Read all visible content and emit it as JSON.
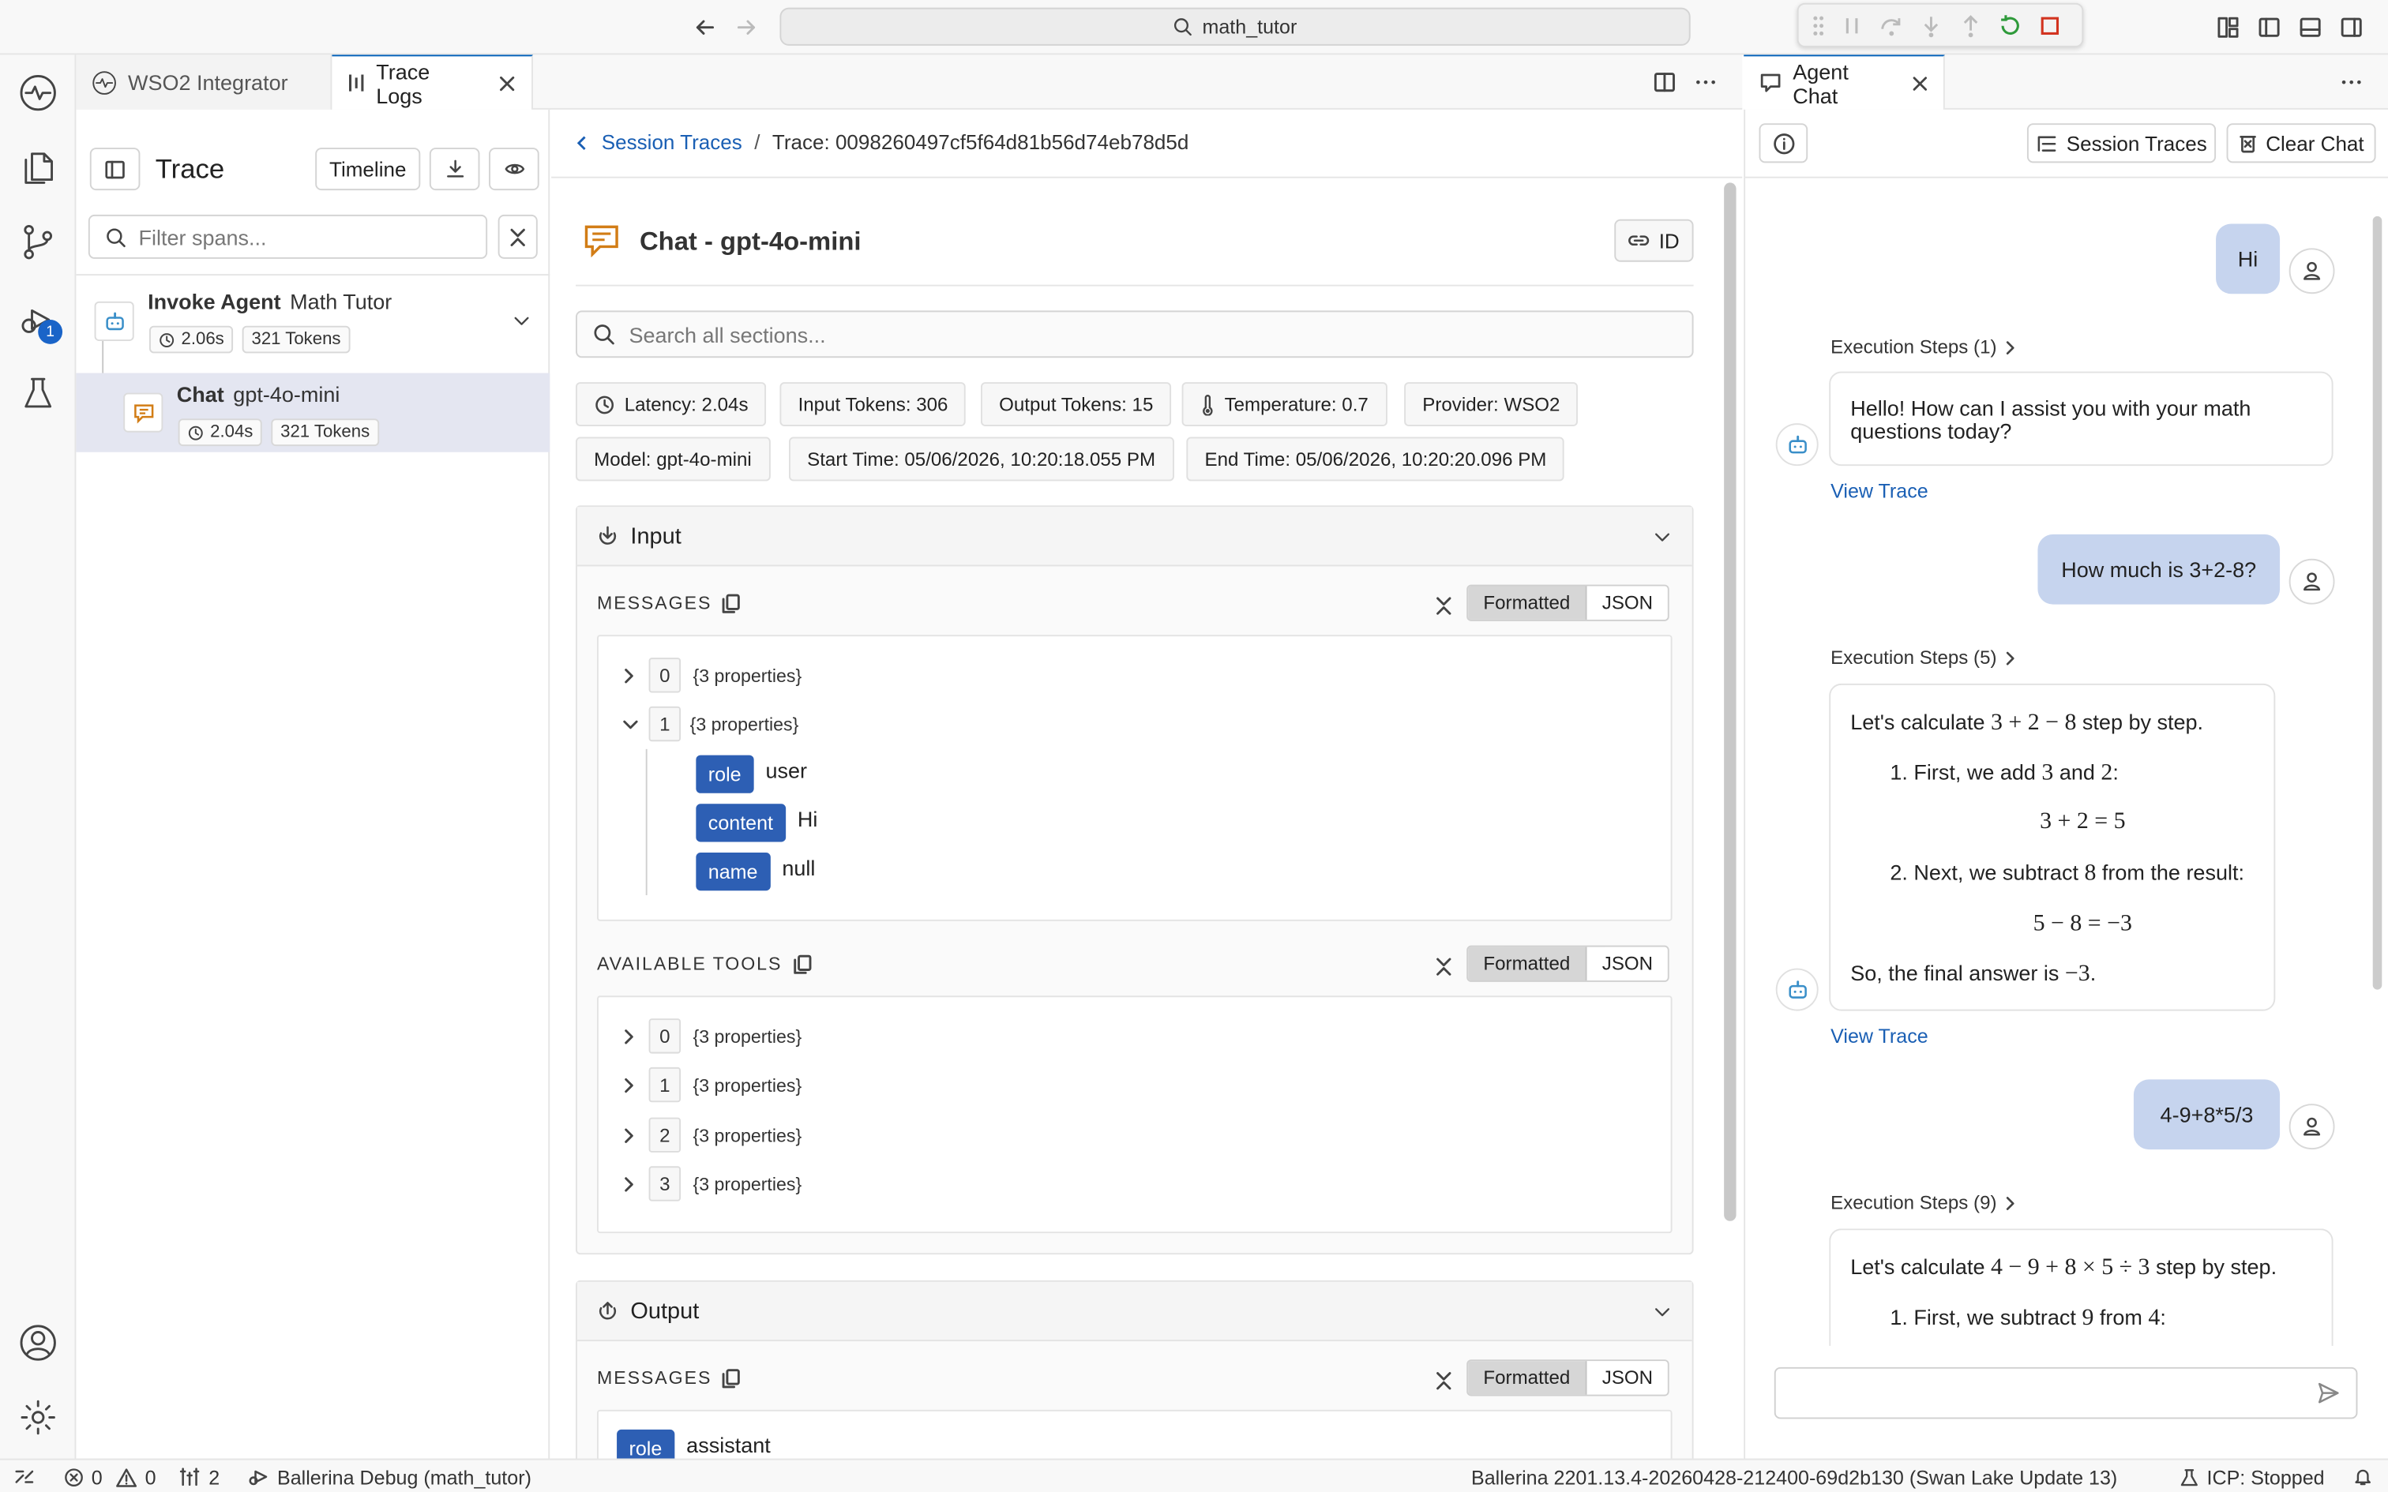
{
  "titlebar": {
    "search_text": "math_tutor"
  },
  "tabs": {
    "integrator": "WSO2 Integrator",
    "trace_logs": "Trace Logs",
    "agent_chat": "Agent Chat"
  },
  "activity": {
    "debug_badge": "1"
  },
  "trace_panel": {
    "title": "Trace",
    "timeline_button": "Timeline",
    "filter_placeholder": "Filter spans...",
    "spans": [
      {
        "kind": "Invoke Agent",
        "name": "Math Tutor",
        "duration": "2.06s",
        "tokens": "321 Tokens"
      },
      {
        "kind": "Chat",
        "name": "gpt-4o-mini",
        "duration": "2.04s",
        "tokens": "321 Tokens"
      }
    ]
  },
  "main": {
    "breadcrumb_link": "Session Traces",
    "breadcrumb_sep": "/",
    "trace_id": "Trace: 0098260497cf5f64d81b56d74eb78d5d",
    "heading": "Chat - gpt-4o-mini",
    "id_button": "ID",
    "search_placeholder": "Search all sections...",
    "pills": {
      "latency": "Latency: 2.04s",
      "input_tokens": "Input Tokens: 306",
      "output_tokens": "Output Tokens: 15",
      "temperature": "Temperature: 0.7",
      "provider": "Provider: WSO2",
      "model": "Model: gpt-4o-mini",
      "start_time": "Start Time: 05/06/2026, 10:20:18.055 PM",
      "end_time": "End Time: 05/06/2026, 10:20:20.096 PM"
    },
    "input_section": {
      "title": "Input",
      "messages_label": "MESSAGES",
      "tools_label": "AVAILABLE TOOLS",
      "formatted": "Formatted",
      "json": "JSON",
      "messages": [
        {
          "index": "0",
          "summary": "{3 properties}"
        },
        {
          "index": "1",
          "summary": "{3 properties}"
        }
      ],
      "message_1_fields": [
        {
          "key": "role",
          "value": "user"
        },
        {
          "key": "content",
          "value": "Hi"
        },
        {
          "key": "name",
          "value": "null"
        }
      ],
      "tools": [
        {
          "index": "0",
          "summary": "{3 properties}"
        },
        {
          "index": "1",
          "summary": "{3 properties}"
        },
        {
          "index": "2",
          "summary": "{3 properties}"
        },
        {
          "index": "3",
          "summary": "{3 properties}"
        }
      ]
    },
    "output_section": {
      "title": "Output",
      "messages_label": "MESSAGES",
      "formatted": "Formatted",
      "json": "JSON",
      "role_key": "role",
      "role_value": "assistant"
    }
  },
  "chat": {
    "session_traces_button": "Session Traces",
    "clear_chat_button": "Clear Chat",
    "view_trace": "View Trace",
    "messages": [
      {
        "user": "Hi",
        "steps": "Execution Steps (1)",
        "reply": "Hello! How can I assist you with your math questions today?"
      },
      {
        "user": "How much is 3+2-8?",
        "steps": "Execution Steps (5)"
      },
      {
        "user": "4-9+8*5/3",
        "steps": "Execution Steps (9)"
      }
    ],
    "reply2": {
      "intro_pre": "Let's calculate ",
      "intro_math": "3 + 2 − 8",
      "intro_post": " step by step.",
      "step1_pre": "1. First, we add ",
      "step1_a": "3",
      "step1_mid": " and ",
      "step1_b": "2",
      "step1_post": ":",
      "eq1": "3 + 2 = 5",
      "step2_pre": "2. Next, we subtract ",
      "step2_a": "8",
      "step2_post": " from the result:",
      "eq2": "5 − 8 = −3",
      "final_pre": "So, the final answer is ",
      "final_math": "−3",
      "final_post": "."
    },
    "reply3": {
      "intro_pre": "Let's calculate ",
      "intro_math": "4 − 9 + 8 × 5 ÷ 3",
      "intro_post": " step by step.",
      "step1_pre": "1. First, we subtract ",
      "step1_a": "9",
      "step1_mid": " from ",
      "step1_b": "4",
      "step1_post": ":"
    }
  },
  "statusbar": {
    "errors": "0",
    "warnings": "0",
    "ports": "2",
    "debug_label": "Ballerina Debug (math_tutor)",
    "version": "Ballerina 2201.13.4-20260428-212400-69d2b130 (Swan Lake Update 13)",
    "icp": "ICP: Stopped"
  }
}
